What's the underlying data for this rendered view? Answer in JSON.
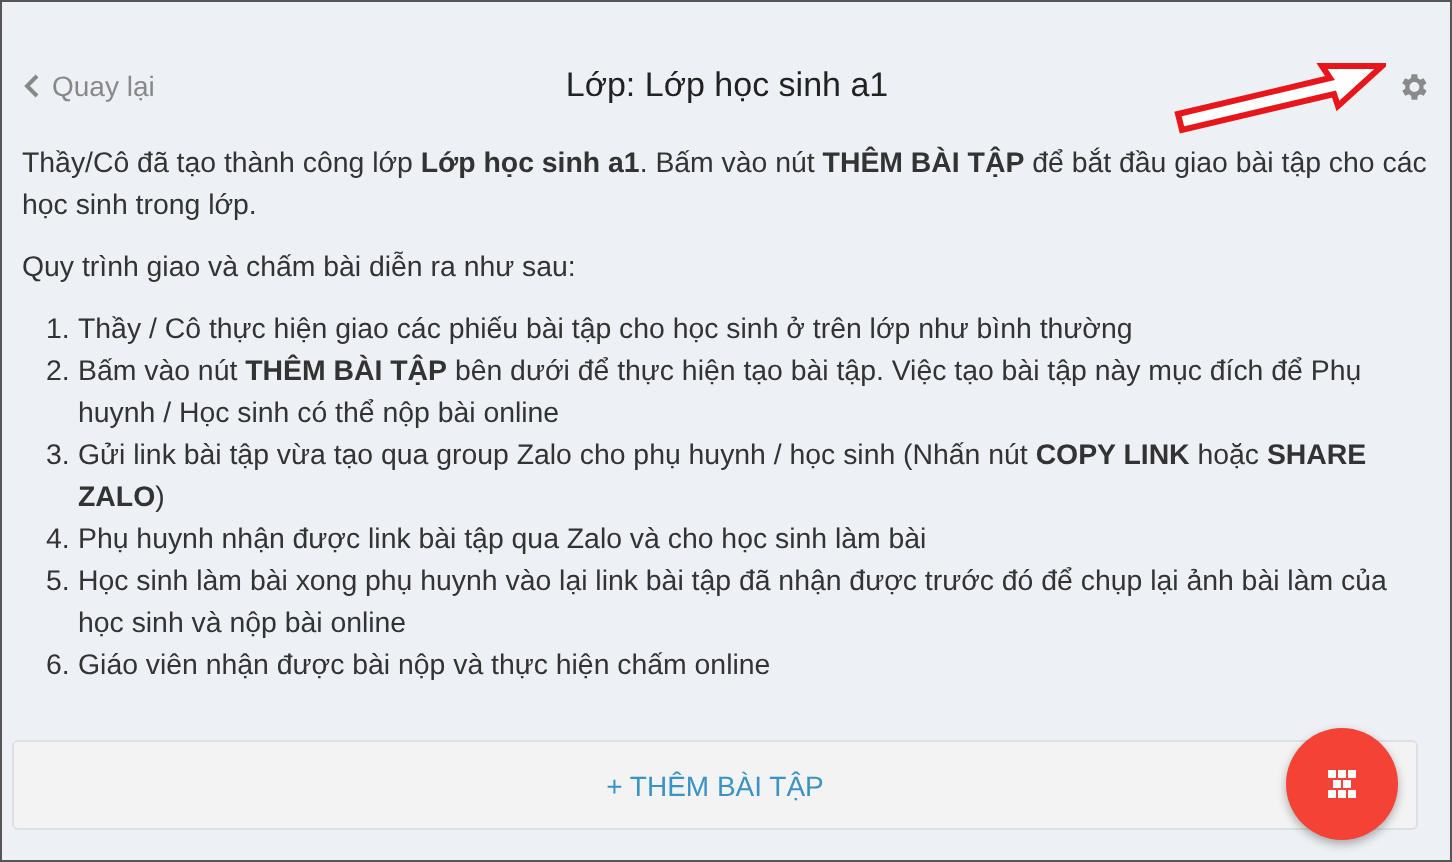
{
  "header": {
    "back": "Quay lại",
    "title": "Lớp: Lớp học sinh a1"
  },
  "intro": "Thầy/Cô đã tạo thành công lớp **Lớp học sinh a1**. Bấm vào nút **THÊM BÀI TẬP** để bắt đầu giao bài tập cho các học sinh trong lớp.",
  "process_heading": "Quy trình giao và chấm bài diễn ra như sau:",
  "steps": [
    {
      "number": "1.",
      "text": "Thầy / Cô thực hiện giao các phiếu bài tập cho học sinh ở trên lớp như bình thường"
    },
    {
      "number": "2.",
      "text": "Bấm vào nút **THÊM BÀI TẬP** bên dưới để thực hiện tạo bài tập. Việc tạo bài tập này mục đích để Phụ huynh / Học sinh có thể nộp bài online"
    },
    {
      "number": "3.",
      "text": "Gửi link bài tập vừa tạo qua group Zalo cho phụ huynh / học sinh (Nhấn nút **COPY LINK** hoặc **SHARE ZALO**)"
    },
    {
      "number": "4.",
      "text": "Phụ huynh nhận được link bài tập qua Zalo và cho học sinh làm bài"
    },
    {
      "number": "5.",
      "text": "Học sinh làm bài xong phụ huynh vào lại link bài tập đã nhận được trước đó để chụp lại ảnh bài làm của học sinh và nộp bài online"
    },
    {
      "number": "6.",
      "text": "Giáo viên nhận được bài nộp và thực hiện chấm online"
    }
  ],
  "add_button": "+ THÊM BÀI TẬP"
}
